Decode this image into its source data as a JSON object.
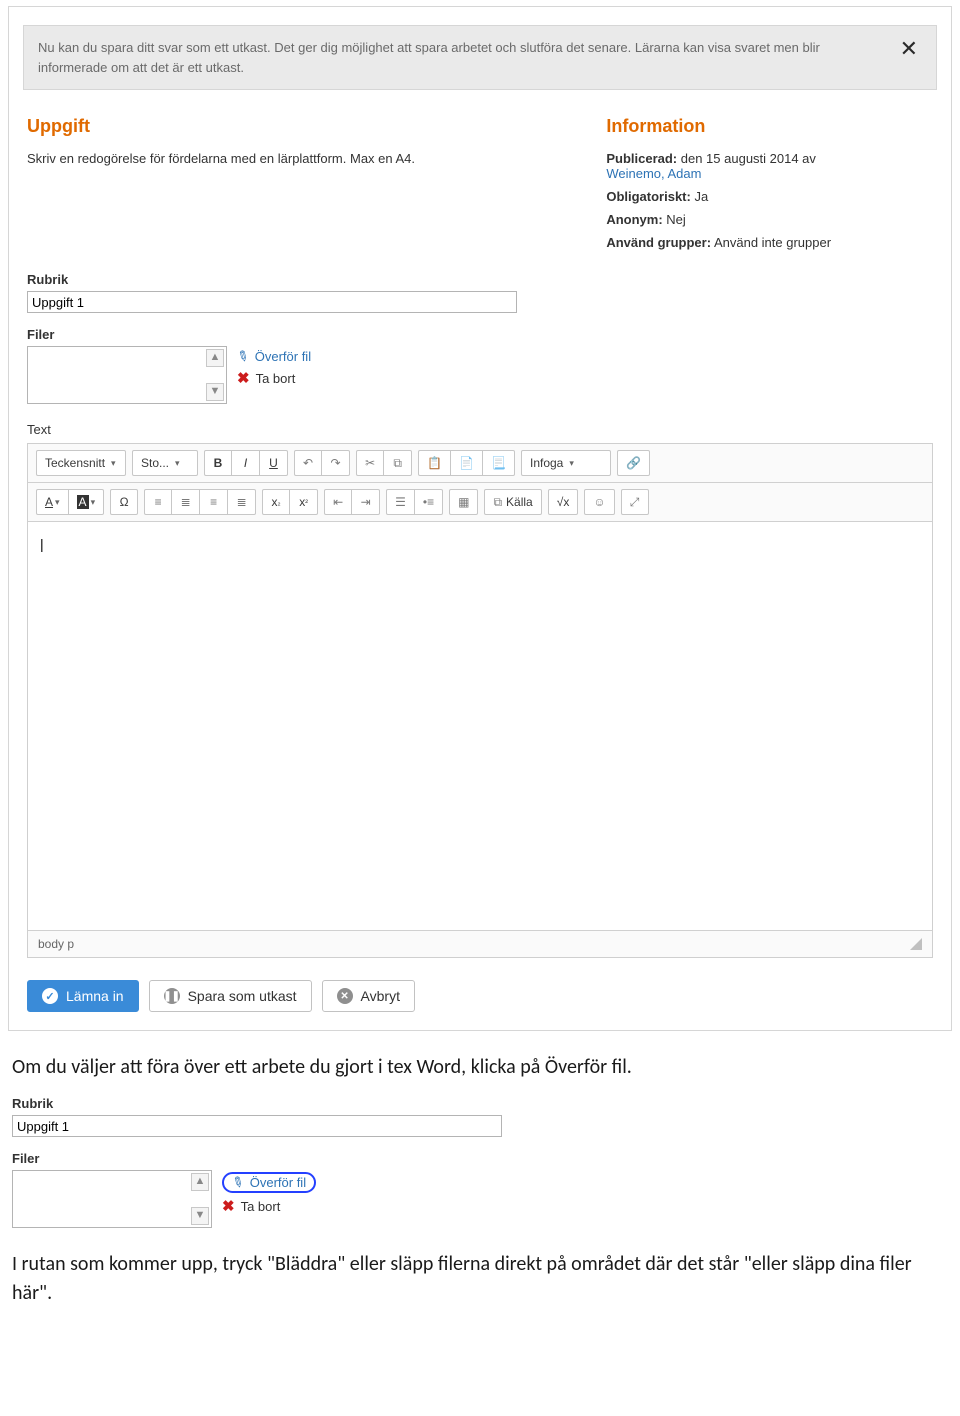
{
  "notice": {
    "text": "Nu kan du spara ditt svar som ett utkast. Det ger dig möjlighet att spara arbetet och slutföra det senare. Lärarna kan visa svaret men blir informerade om att det är ett utkast."
  },
  "task": {
    "heading": "Uppgift",
    "description": "Skriv en redogörelse för fördelarna med en lärplattform. Max en A4."
  },
  "info": {
    "heading": "Information",
    "published_label": "Publicerad:",
    "published_value": "den 15 augusti 2014 av",
    "published_author": "Weinemo, Adam",
    "mandatory_label": "Obligatoriskt:",
    "mandatory_value": "Ja",
    "anon_label": "Anonym:",
    "anon_value": "Nej",
    "groups_label": "Använd grupper:",
    "groups_value": "Använd inte grupper"
  },
  "form": {
    "rubrik_label": "Rubrik",
    "rubrik_value": "Uppgift 1",
    "filer_label": "Filer",
    "overfor": "Överför fil",
    "tabort": "Ta bort",
    "text_label": "Text"
  },
  "toolbar": {
    "font": "Teckensnitt",
    "size": "Sto...",
    "insert": "Infoga",
    "source": "Källa"
  },
  "editor": {
    "body_text": "|",
    "status_path": "body  p"
  },
  "buttons": {
    "submit": "Lämna in",
    "draft": "Spara som utkast",
    "cancel": "Avbryt"
  },
  "doc": {
    "para1": "Om du väljer att föra över ett arbete du gjort i tex Word, klicka på Överför fil.",
    "para2": "I rutan som kommer upp, tryck \"Bläddra\" eller släpp filerna direkt på området där det står \"eller släpp dina filer här\"."
  },
  "snippet": {
    "rubrik_label": "Rubrik",
    "rubrik_value": "Uppgift 1",
    "filer_label": "Filer",
    "overfor": "Överför fil",
    "tabort": "Ta bort"
  }
}
